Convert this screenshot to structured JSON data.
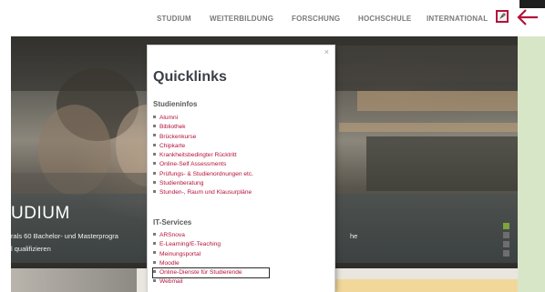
{
  "topnav": {
    "items": [
      "STUDIUM",
      "WEITERBILDUNG",
      "FORSCHUNG",
      "HOCHSCHULE",
      "INTERNATIONAL"
    ]
  },
  "hero": {
    "title": "UDIUM",
    "line1": "rals 60 Bachelor- und Masterprogra",
    "line2": "l qualifizieren",
    "right_text": "he"
  },
  "quicklinks": {
    "title": "Quicklinks",
    "close": "×",
    "sections": [
      {
        "heading": "Studieninfos",
        "links": [
          "Alumni",
          "Bibliothek",
          "Brückenkurse",
          "Chipkarte",
          "Krankheitsbedingter Rücktritt",
          "Online-Self Assessments",
          "Prüfungs- & Studienordnungen etc.",
          "Studienberatung",
          "Stunden-, Raum und Klausurpläne"
        ]
      },
      {
        "heading": "IT-Services",
        "links": [
          "ARSnova",
          "E-Learning/E-Teaching",
          "Meinungsportal",
          "Moodle",
          "Online-Dienste für Studierende",
          "Webmail"
        ]
      }
    ]
  },
  "colors": {
    "accent": "#b3133a",
    "link": "#b3133a",
    "slider_active": "#7ea43b"
  },
  "icons": {
    "quicklinks_toggle": "bookmark-icon",
    "arrow": "arrow-left-icon"
  }
}
